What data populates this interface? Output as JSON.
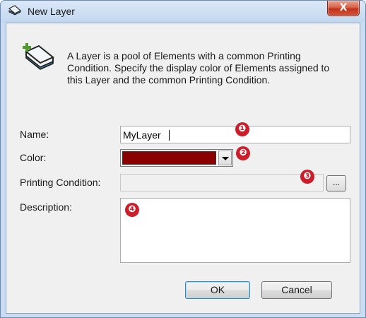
{
  "window": {
    "title": "New Layer",
    "close_label": "X"
  },
  "header": {
    "icon": "layer-add-icon",
    "description": "A Layer is a pool of Elements with a common Printing Condition. Specify the display color of Elements assigned to this Layer and the common Printing Condition."
  },
  "form": {
    "name_label": "Name:",
    "name_value": "MyLayer",
    "color_label": "Color:",
    "color_value": "#8b0000",
    "printing_condition_label": "Printing Condition:",
    "printing_condition_value": "",
    "browse_label": "...",
    "description_label": "Description:",
    "description_value": ""
  },
  "buttons": {
    "ok_label": "OK",
    "cancel_label": "Cancel"
  },
  "callouts": [
    "❶",
    "❷",
    "❸",
    "❹"
  ],
  "colors": {
    "callout": "#cc1d2b",
    "close_button": "#c83a22",
    "selected_color": "#8b0000"
  }
}
